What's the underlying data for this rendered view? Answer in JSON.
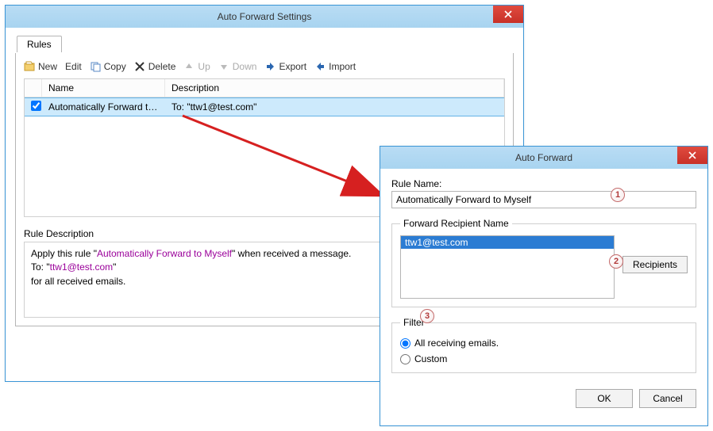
{
  "window1": {
    "title": "Auto Forward Settings",
    "tab": "Rules",
    "toolbar": {
      "new": "New",
      "edit": "Edit",
      "copy": "Copy",
      "delete": "Delete",
      "up": "Up",
      "down": "Down",
      "export": "Export",
      "import": "Import"
    },
    "columns": {
      "name": "Name",
      "description": "Description"
    },
    "rule": {
      "checked": true,
      "name": "Automatically Forward to...",
      "description": "To: \"ttw1@test.com\""
    },
    "desc_label": "Rule Description",
    "desc": {
      "pre": "Apply this rule \"",
      "link1": "Automatically Forward to Myself",
      "mid": "\" when received a message.",
      "to_pre": "To: \"",
      "link2": "ttw1@test.com",
      "to_post": "\"",
      "line3": "for all received emails."
    }
  },
  "window2": {
    "title": "Auto Forward",
    "ruleName_label": "Rule Name:",
    "ruleName_value": "Automatically Forward to Myself",
    "recipient_legend": "Forward Recipient Name",
    "recipient_item": "ttw1@test.com",
    "recipients_btn": "Recipients",
    "filter_legend": "Filter",
    "filter_all": "All receiving emails.",
    "filter_custom": "Custom",
    "ok": "OK",
    "cancel": "Cancel"
  },
  "callouts": {
    "c1": "1",
    "c2": "2",
    "c3": "3"
  }
}
